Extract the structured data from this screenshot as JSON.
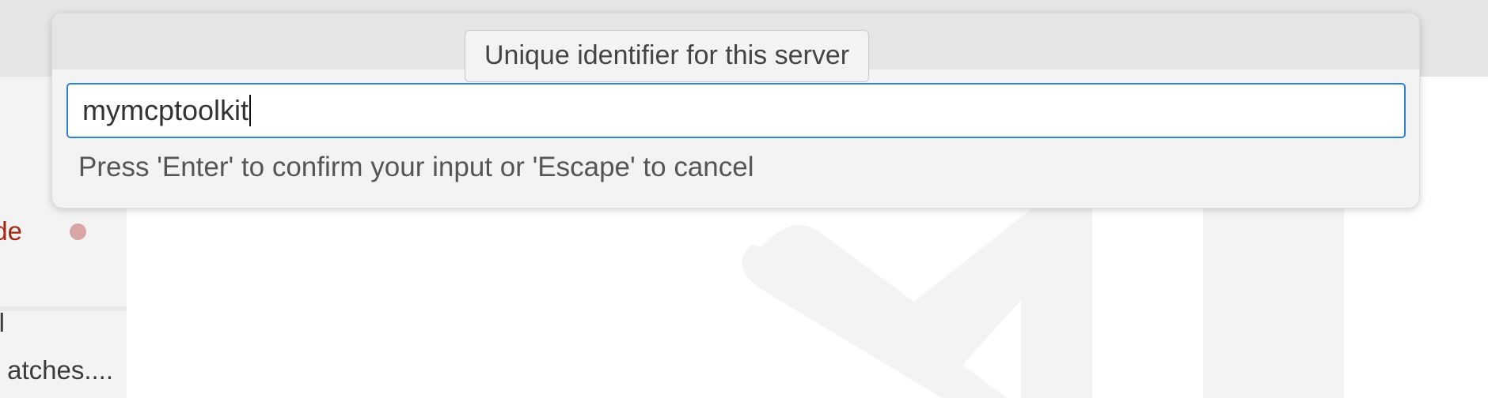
{
  "quick_input": {
    "title": "Unique identifier for this server",
    "input_value": "mymcptoolkit",
    "message": "Press 'Enter' to confirm your input or 'Escape' to cancel"
  },
  "sidebar": {
    "item_partial_1": "de",
    "item_partial_2": "l",
    "item_partial_3": "atches...."
  },
  "colors": {
    "accent": "#2f80d1",
    "modified_text": "#a1260d",
    "modified_dot": "#d9a6a6"
  },
  "icons": {
    "watermark": "vscode-logo-watermark",
    "dot": "modified-dot-icon"
  }
}
